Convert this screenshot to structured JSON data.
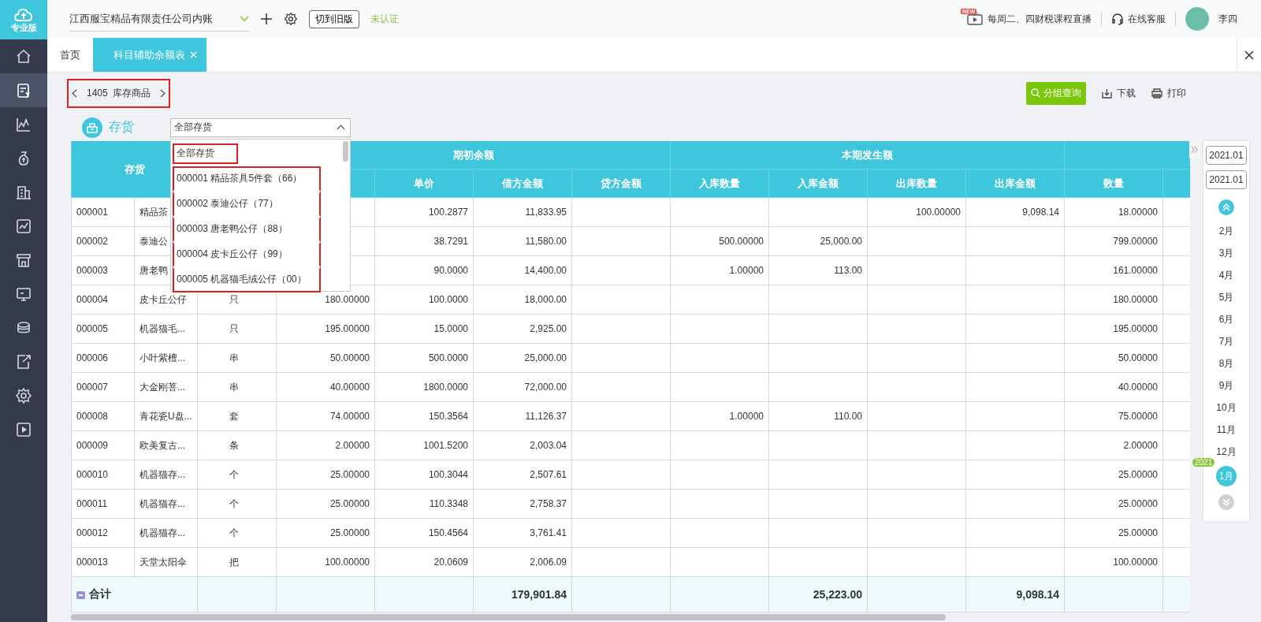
{
  "logo": {
    "label": "专业版"
  },
  "sidebar": {
    "items": [
      {
        "selected": false
      },
      {
        "selected": true
      },
      {
        "selected": false
      },
      {
        "selected": false
      },
      {
        "selected": false
      },
      {
        "selected": false
      },
      {
        "selected": false
      },
      {
        "selected": false
      },
      {
        "selected": false
      },
      {
        "selected": false
      },
      {
        "selected": false
      },
      {
        "selected": false
      }
    ]
  },
  "header": {
    "company": "江西服宝精品有限责任公司内账",
    "switch_button": "切到旧版",
    "status": "未认证",
    "live_badge": "NEW",
    "live_link": "每周二、四财税课程直播",
    "service_link": "在线客服",
    "user": "李四"
  },
  "tabs": [
    {
      "label": "首页",
      "selected": false,
      "closable": false
    },
    {
      "label": "科目辅助余额表",
      "selected": true,
      "closable": true
    }
  ],
  "subject": {
    "code": "1405",
    "name": "库存商品"
  },
  "actions": {
    "group_query": "分组查询",
    "download": "下载",
    "print": "打印"
  },
  "section": {
    "title": "存货",
    "filter": {
      "value": "全部存货",
      "expanded": true,
      "options": [
        {
          "label": "全部存货",
          "kind": "all",
          "highlighted": true
        },
        {
          "label": "000001 精品茶具5件套（66）",
          "kind": "item",
          "highlighted": true
        },
        {
          "label": "000002 泰迪公仔（77）",
          "kind": "item",
          "highlighted": true
        },
        {
          "label": "000003 唐老鸭公仔（88）",
          "kind": "item",
          "highlighted": true
        },
        {
          "label": "000004 皮卡丘公仔（99）",
          "kind": "item",
          "highlighted": true
        },
        {
          "label": "000005 机器猫毛绒公仔（00）",
          "kind": "item",
          "highlighted": true
        }
      ]
    }
  },
  "table": {
    "groups": [
      {
        "label": "存货"
      },
      {
        "label": "期初余额"
      },
      {
        "label": "本期发生额"
      }
    ],
    "columns": [
      "单价",
      "借方金额",
      "贷方金额",
      "入库数量",
      "入库金额",
      "出库数量",
      "出库金额",
      "数量"
    ],
    "rows": [
      {
        "code": "000001",
        "name": "精品茶",
        "unit_price": "100.2877",
        "debit": "11,833.95",
        "out_qty": "100.00000",
        "out_amount": "9,098.14",
        "closing_qty": "18.00000"
      },
      {
        "code": "000002",
        "name": "泰迪公",
        "unit_price": "38.7291",
        "debit": "11,580.00",
        "in_qty": "500.00000",
        "in_amount": "25,000.00",
        "closing_qty": "799.00000"
      },
      {
        "code": "000003",
        "name": "唐老鸭",
        "unit_price": "90.0000",
        "debit": "14,400.00",
        "in_qty": "1.00000",
        "in_amount": "113.00",
        "closing_qty": "161.00000"
      },
      {
        "code": "000004",
        "name": "皮卡丘公仔",
        "unit": "只",
        "opening_qty": "180.00000",
        "unit_price": "100.0000",
        "debit": "18,000.00",
        "closing_qty": "180.00000"
      },
      {
        "code": "000005",
        "name": "机器猫毛...",
        "unit": "只",
        "opening_qty": "195.00000",
        "unit_price": "15.0000",
        "debit": "2,925.00",
        "closing_qty": "195.00000"
      },
      {
        "code": "000006",
        "name": "小叶紫檀...",
        "unit": "串",
        "opening_qty": "50.00000",
        "unit_price": "500.0000",
        "debit": "25,000.00",
        "closing_qty": "50.00000"
      },
      {
        "code": "000007",
        "name": "大金刚菩...",
        "unit": "串",
        "opening_qty": "40.00000",
        "unit_price": "1800.0000",
        "debit": "72,000.00",
        "closing_qty": "40.00000"
      },
      {
        "code": "000008",
        "name": "青花瓷U盘...",
        "unit": "套",
        "opening_qty": "74.00000",
        "unit_price": "150.3564",
        "debit": "11,126.37",
        "in_qty": "1.00000",
        "in_amount": "110.00",
        "closing_qty": "75.00000"
      },
      {
        "code": "000009",
        "name": "欧美复古...",
        "unit": "条",
        "opening_qty": "2.00000",
        "unit_price": "1001.5200",
        "debit": "2,003.04",
        "closing_qty": "2.00000"
      },
      {
        "code": "000010",
        "name": "机器猫存...",
        "unit": "个",
        "opening_qty": "25.00000",
        "unit_price": "100.3044",
        "debit": "2,507.61",
        "closing_qty": "25.00000"
      },
      {
        "code": "000011",
        "name": "机器猫存...",
        "unit": "个",
        "opening_qty": "25.00000",
        "unit_price": "110.3348",
        "debit": "2,758.37",
        "closing_qty": "25.00000"
      },
      {
        "code": "000012",
        "name": "机器猫存...",
        "unit": "个",
        "opening_qty": "25.00000",
        "unit_price": "150.4564",
        "debit": "3,761.41",
        "closing_qty": "25.00000"
      },
      {
        "code": "000013",
        "name": "天堂太阳伞",
        "unit": "把",
        "opening_qty": "100.00000",
        "unit_price": "20.0609",
        "debit": "2,006.09",
        "closing_qty": "100.00000"
      }
    ],
    "total": {
      "code": "合计",
      "debit": "179,901.84",
      "in_amount": "25,223.00",
      "out_amount": "9,098.14"
    }
  },
  "period": {
    "start": "2021.01",
    "end": "2021.01",
    "months": [
      {
        "label": "2月",
        "selected": false
      },
      {
        "label": "3月",
        "selected": false
      },
      {
        "label": "4月",
        "selected": false
      },
      {
        "label": "5月",
        "selected": false
      },
      {
        "label": "6月",
        "selected": false
      },
      {
        "label": "7月",
        "selected": false
      },
      {
        "label": "8月",
        "selected": false
      },
      {
        "label": "9月",
        "selected": false
      },
      {
        "label": "10月",
        "selected": false
      },
      {
        "label": "11月",
        "selected": false
      },
      {
        "label": "12月",
        "selected": false
      },
      {
        "label": "1月",
        "selected": true,
        "year": "2021"
      }
    ]
  }
}
